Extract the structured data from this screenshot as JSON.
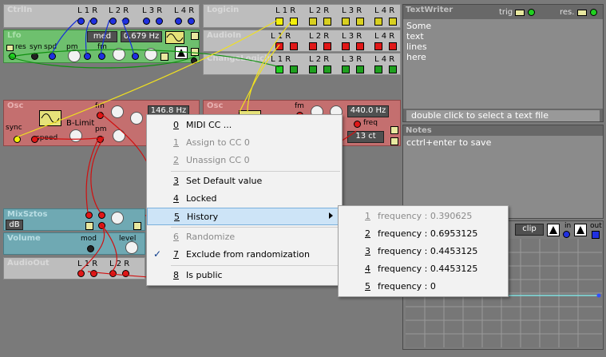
{
  "modules": {
    "ctrlin": {
      "title": "CtrlIn",
      "ports": [
        "L 1 R",
        "L 2 R",
        "L 3 R",
        "L 4 R"
      ]
    },
    "logicin": {
      "title": "Logicin",
      "ports": [
        "L 1 R",
        "L 2 R",
        "L 3 R",
        "L 4 R"
      ]
    },
    "lfo": {
      "title": "Lfo",
      "shape_label": "med",
      "freq": "0.679 Hz",
      "labels": [
        "res",
        "syn",
        "spd",
        "pm",
        "fm"
      ]
    },
    "audioin": {
      "title": "AudioIn",
      "ports": [
        "L 1 R",
        "L 2 R",
        "L 3 R",
        "L 4 R"
      ]
    },
    "changelogicin": {
      "title": "ChangeLogicin",
      "ports": [
        "L 1 R",
        "L 2 R",
        "L 3 R",
        "L 4 R"
      ]
    },
    "osc1": {
      "title": "Osc",
      "freq": "146.8 Hz",
      "mode": "B-Limit",
      "labels": [
        "fm",
        "pm",
        "sync",
        "speed"
      ]
    },
    "osc2": {
      "title": "Osc",
      "freq": "440.0 Hz",
      "cents": "13 ct",
      "labels": [
        "fm",
        "freq"
      ]
    },
    "mixsztos": {
      "title": "MixSztos",
      "unit": "dB"
    },
    "volume": {
      "title": "Volume",
      "labels": [
        "mod",
        "level"
      ]
    },
    "audioout": {
      "title": "AudioOut",
      "ports": [
        "L 1 R",
        "L 2 R"
      ]
    },
    "scope": {
      "clip_label": "clip",
      "in_label": "in",
      "out_label": "out"
    }
  },
  "textwriter": {
    "title": "TextWriter",
    "trig": "trig",
    "res": "res.",
    "lines": [
      "Some",
      "text",
      "lines",
      "here"
    ],
    "footer": "double click to select a text file"
  },
  "notes": {
    "title": "Notes",
    "content": "cctrl+enter to save"
  },
  "context_menu": {
    "items": [
      {
        "num": "0",
        "label": "MIDI CC ...",
        "disabled": false
      },
      {
        "num": "1",
        "label": "Assign to CC 0",
        "disabled": true
      },
      {
        "num": "2",
        "label": "Unassign CC 0",
        "disabled": true
      },
      {
        "num": "3",
        "label": "Set Default value",
        "disabled": false
      },
      {
        "num": "4",
        "label": "Locked",
        "disabled": false
      },
      {
        "num": "5",
        "label": "History",
        "disabled": false
      },
      {
        "num": "6",
        "label": "Randomize",
        "disabled": true
      },
      {
        "num": "7",
        "label": "Exclude from randomization",
        "disabled": false,
        "checked": true
      },
      {
        "num": "8",
        "label": "Is public",
        "disabled": false
      }
    ]
  },
  "history_menu": {
    "items": [
      {
        "num": "1",
        "label": "frequency : 0.390625",
        "disabled": true
      },
      {
        "num": "2",
        "label": "frequency : 0.6953125",
        "disabled": false
      },
      {
        "num": "3",
        "label": "frequency : 0.4453125",
        "disabled": false
      },
      {
        "num": "4",
        "label": "frequency : 0.4453125",
        "disabled": false
      },
      {
        "num": "5",
        "label": "frequency : 0",
        "disabled": false
      }
    ]
  },
  "colors": {
    "accent_highlight": "#cde4f7",
    "cable_red": "#d01010",
    "cable_yellow": "#f0e020",
    "cable_blue": "#1830d8",
    "cable_green": "#109010"
  }
}
